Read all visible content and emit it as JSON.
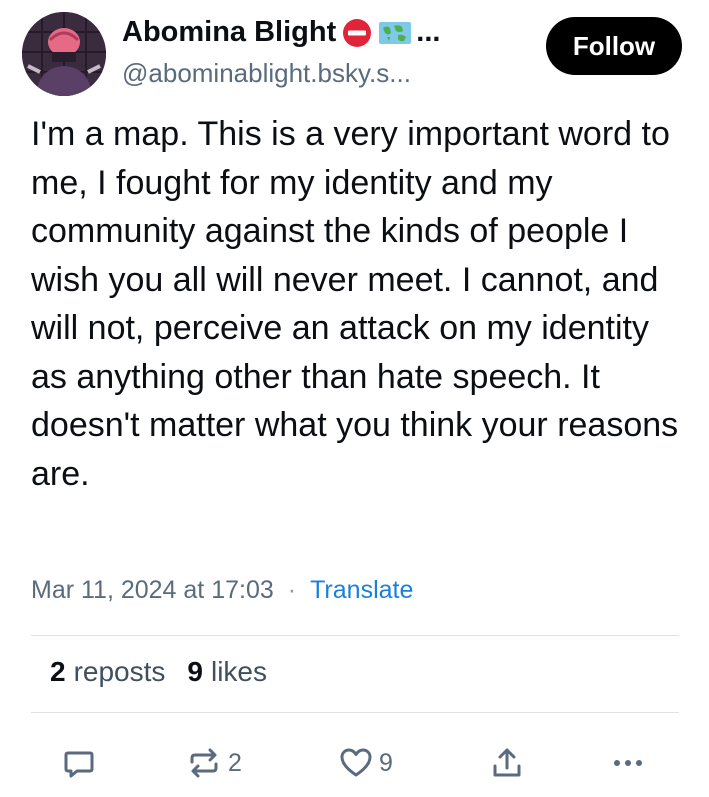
{
  "author": {
    "display_name": "Abomina Blight",
    "name_suffix": "...",
    "handle": "@abominablight.bsky.s...",
    "avatar_icon": "user-avatar",
    "badges": [
      "no-entry-emoji",
      "world-map-emoji"
    ]
  },
  "follow_button": {
    "label": "Follow"
  },
  "post": {
    "text": "I'm a map. This is a very important word to me, I fought for my identity and my community against the kinds of people I wish you all will never meet. I cannot, and will not, perceive an attack on my identity as anything other than hate speech. It doesn't matter what you think your reasons are."
  },
  "meta": {
    "timestamp": "Mar 11, 2024 at 17:03",
    "separator": "·",
    "translate_label": "Translate"
  },
  "stats": {
    "reposts_count": "2",
    "reposts_label": "reposts",
    "likes_count": "9",
    "likes_label": "likes"
  },
  "actions": {
    "reply_icon": "reply-icon",
    "repost_icon": "repost-icon",
    "repost_count": "2",
    "like_icon": "heart-icon",
    "like_count": "9",
    "share_icon": "share-icon",
    "more_icon": "more-icon"
  },
  "colors": {
    "text": "#0b0f14",
    "muted": "#5a6b7d",
    "link": "#1d80d8",
    "button_bg": "#000000",
    "divider": "#dfe3e8"
  }
}
